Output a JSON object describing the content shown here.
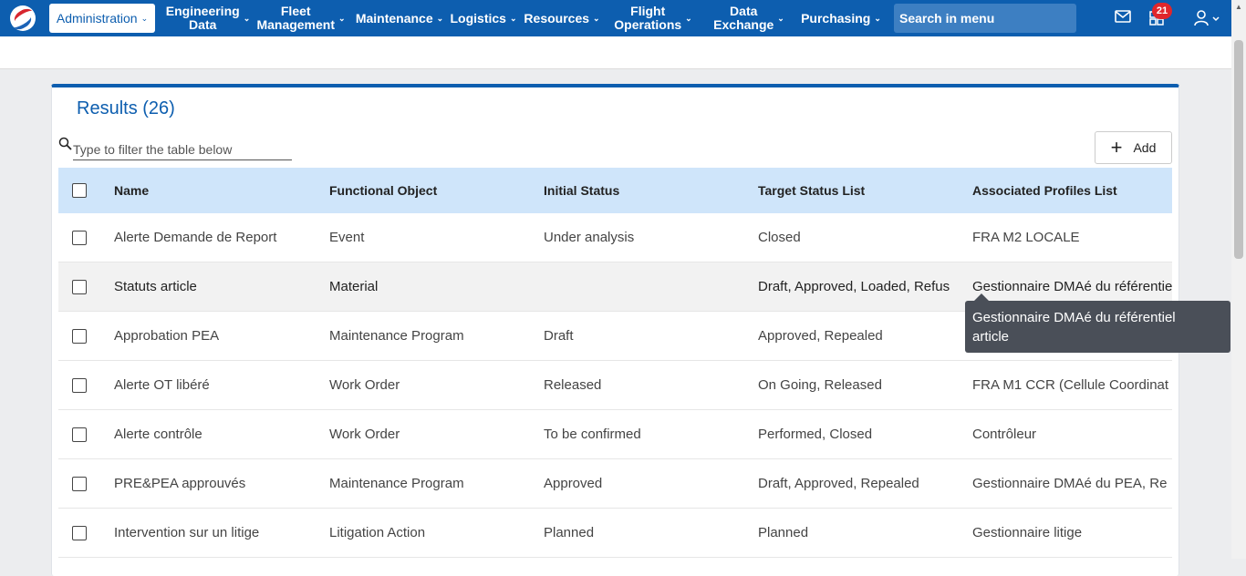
{
  "nav": {
    "items": [
      {
        "label": "Administration",
        "active": true
      },
      {
        "label_line1": "Engineering",
        "label_line2": "Data"
      },
      {
        "label_line1": "Fleet",
        "label_line2": "Management"
      },
      {
        "label": "Maintenance"
      },
      {
        "label": "Logistics"
      },
      {
        "label": "Resources"
      },
      {
        "label_line1": "Flight",
        "label_line2": "Operations"
      },
      {
        "label_line1": "Data",
        "label_line2": "Exchange"
      },
      {
        "label": "Purchasing"
      }
    ],
    "search_placeholder": "Search in menu",
    "notification_count": "21",
    "icons": [
      "mail-icon",
      "dashboard-icon",
      "user-icon"
    ],
    "brand_color": "#0d5eaf"
  },
  "results": {
    "title": "Results (26)",
    "filter_placeholder": "Type to filter the table below",
    "add_label": "Add"
  },
  "table": {
    "headers": [
      "Name",
      "Functional Object",
      "Initial Status",
      "Target Status List",
      "Associated Profiles List"
    ],
    "rows": [
      {
        "name": "Alerte Demande de Report",
        "object": "Event",
        "initial": "Under analysis",
        "target": "Closed",
        "profiles": "FRA M2 LOCALE"
      },
      {
        "name": "Statuts article",
        "object": "Material",
        "initial": "",
        "target": "Draft, Approved, Loaded, Refus",
        "profiles": "Gestionnaire DMAé du référentiel"
      },
      {
        "name": "Approbation PEA",
        "object": "Maintenance Program",
        "initial": "Draft",
        "target": "Approved, Repealed",
        "profiles": ""
      },
      {
        "name": "Alerte OT libéré",
        "object": "Work Order",
        "initial": "Released",
        "target": "On Going, Released",
        "profiles": "FRA M1 CCR (Cellule Coordinat"
      },
      {
        "name": "Alerte contrôle",
        "object": "Work Order",
        "initial": "To be confirmed",
        "target": "Performed, Closed",
        "profiles": "Contrôleur"
      },
      {
        "name": "PRE&PEA approuvés",
        "object": "Maintenance Program",
        "initial": "Approved",
        "target": "Draft, Approved, Repealed",
        "profiles": "Gestionnaire DMAé du PEA, Re"
      },
      {
        "name": "Intervention sur un litige",
        "object": "Litigation Action",
        "initial": "Planned",
        "target": "Planned",
        "profiles": "Gestionnaire litige"
      }
    ]
  },
  "tooltip": {
    "line1": "Gestionnaire DMAé du référentiel",
    "line2": "article"
  }
}
